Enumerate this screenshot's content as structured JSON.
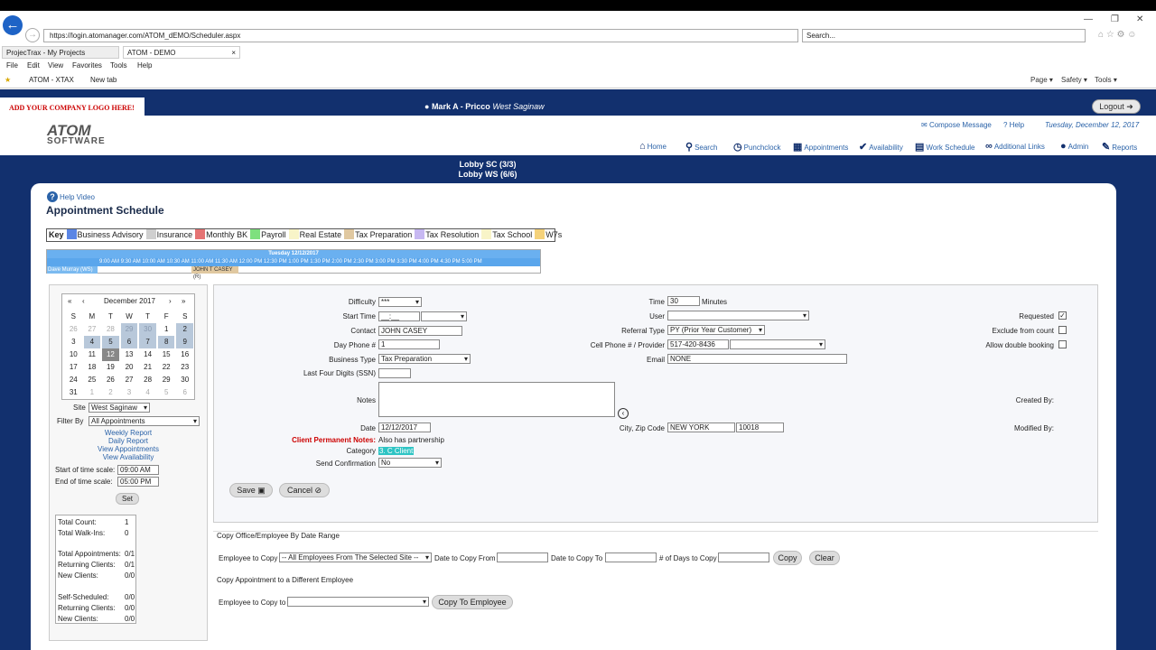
{
  "browser": {
    "url": "https://login.atomanager.com/ATOM_dEMO/Scheduler.aspx",
    "search_placeholder": "Search...",
    "tabs": [
      "ProjecTrax - My Projects",
      "ATOM - DEMO"
    ],
    "menu": [
      "File",
      "Edit",
      "View",
      "Favorites",
      "Tools",
      "Help"
    ],
    "favorites": [
      "ATOM - XTAX",
      "New tab"
    ],
    "commands": [
      "Page ▾",
      "Safety ▾",
      "Tools ▾"
    ]
  },
  "header": {
    "logo_caption": "ADD YOUR COMPANY LOGO HERE!",
    "logo_main": "ATOM",
    "logo_sub": "SOFTWARE",
    "user_name": "Mark A - Pricco",
    "user_site": "West Saginaw",
    "logout": "Logout",
    "compose": "Compose Message",
    "help": "Help",
    "date": "Tuesday, December 12, 2017",
    "nav": [
      "Home",
      "Search",
      "Punchclock",
      "Appointments",
      "Availability",
      "Work Schedule",
      "Additional Links",
      "Admin",
      "Reports"
    ],
    "lobby": [
      "Lobby SC (3/3)",
      "Lobby WS (6/6)"
    ]
  },
  "page": {
    "help_video": "Help Video",
    "title": "Appointment Schedule"
  },
  "key": {
    "label": "Key",
    "items": [
      {
        "name": "Business Advisory",
        "color": "#5b86e5"
      },
      {
        "name": "Insurance",
        "color": "#cfcfcf"
      },
      {
        "name": "Monthly BK",
        "color": "#e57373"
      },
      {
        "name": "Payroll",
        "color": "#7ee07e"
      },
      {
        "name": "Real Estate",
        "color": "#f8f4c8"
      },
      {
        "name": "Tax Preparation",
        "color": "#e0c8a0"
      },
      {
        "name": "Tax Resolution",
        "color": "#c7b8f2"
      },
      {
        "name": "Tax School",
        "color": "#f8f4c8"
      },
      {
        "name": "W7s",
        "color": "#f5d27a"
      }
    ]
  },
  "mini_schedule": {
    "date": "Tuesday 12/12/2017",
    "times": "9:00 AM  9:30 AM  10:00 AM  10:30 AM 11:00 AM 11:30 AM 12:00 PM 12:30 PM 1:00 PM 1:30 PM 2:00 PM 2:30 PM 3:00 PM 3:30 PM 4:00 PM 4:30 PM 5:00 PM",
    "employee": "Dave Murray (WS)",
    "appointment": "JOHN T CASEY (R)"
  },
  "calendar": {
    "month": "December 2017",
    "weekdays": [
      "S",
      "M",
      "T",
      "W",
      "T",
      "F",
      "S"
    ],
    "weeks": [
      [
        "26",
        "27",
        "28",
        "29",
        "30",
        "1",
        "2"
      ],
      [
        "3",
        "4",
        "5",
        "6",
        "7",
        "8",
        "9"
      ],
      [
        "10",
        "11",
        "12",
        "13",
        "14",
        "15",
        "16"
      ],
      [
        "17",
        "18",
        "19",
        "20",
        "21",
        "22",
        "23"
      ],
      [
        "24",
        "25",
        "26",
        "27",
        "28",
        "29",
        "30"
      ],
      [
        "31",
        "1",
        "2",
        "3",
        "4",
        "5",
        "6"
      ]
    ]
  },
  "left": {
    "site_label": "Site",
    "site_value": "West Saginaw",
    "filter_label": "Filter By",
    "filter_value": "All Appointments",
    "links": [
      "Weekly Report",
      "Daily Report",
      "View Appointments",
      "View Availability"
    ],
    "start_label": "Start of time scale:",
    "start_value": "09:00 AM",
    "end_label": "End of time scale:",
    "end_value": "05:00 PM",
    "set": "Set",
    "stats": [
      {
        "label": "Total Count:",
        "value": "1"
      },
      {
        "label": "Total Walk-Ins:",
        "value": "0"
      },
      {
        "label": "Total Appointments:",
        "value": "0/1"
      },
      {
        "label": "Returning Clients:",
        "value": "0/1"
      },
      {
        "label": "New Clients:",
        "value": "0/0"
      },
      {
        "label": "Self-Scheduled:",
        "value": "0/0"
      },
      {
        "label": "Returning Clients:",
        "value": "0/0"
      },
      {
        "label": "New Clients:",
        "value": "0/0"
      }
    ]
  },
  "form": {
    "difficulty_label": "Difficulty",
    "difficulty": "***",
    "start_time_label": "Start Time",
    "start_time": "__:__",
    "contact_label": "Contact",
    "contact": "JOHN  CASEY",
    "day_phone_label": "Day Phone #",
    "day_phone": "1",
    "business_type_label": "Business Type",
    "business_type": "Tax Preparation",
    "ssn_label": "Last Four Digits (SSN)",
    "notes_label": "Notes",
    "date_label": "Date",
    "date": "12/12/2017",
    "perm_notes_label": "Client Permanent Notes:",
    "perm_notes": "Also has partnership",
    "category_label": "Category",
    "category": "3. C Client",
    "send_conf_label": "Send Confirmation",
    "send_conf": "No",
    "time_label": "Time",
    "time": "30",
    "minutes": "Minutes",
    "user_label": "User",
    "referral_label": "Referral Type",
    "referral": "PY (Prior Year Customer)",
    "cell_label": "Cell Phone # / Provider",
    "cell": "517-420-8436",
    "email_label": "Email",
    "email": "NONE",
    "city_label": "City, Zip Code",
    "city": "NEW YORK",
    "zip": "10018",
    "requested_label": "Requested",
    "exclude_label": "Exclude from count",
    "double_label": "Allow double booking",
    "created_label": "Created By:",
    "modified_label": "Modified By:",
    "save": "Save",
    "cancel": "Cancel"
  },
  "copy": {
    "range_title": "Copy Office/Employee By Date Range",
    "emp_label": "Employee to Copy",
    "emp_value": "-- All Employees From The Selected Site --",
    "from_label": "Date to Copy From",
    "to_label": "Date to Copy To",
    "days_label": "# of Days to Copy",
    "copy_btn": "Copy",
    "clear_btn": "Clear",
    "diff_title": "Copy Appointment to a Different Employee",
    "emp_copy_label": "Employee to Copy to",
    "copy_emp_btn": "Copy To Employee"
  }
}
